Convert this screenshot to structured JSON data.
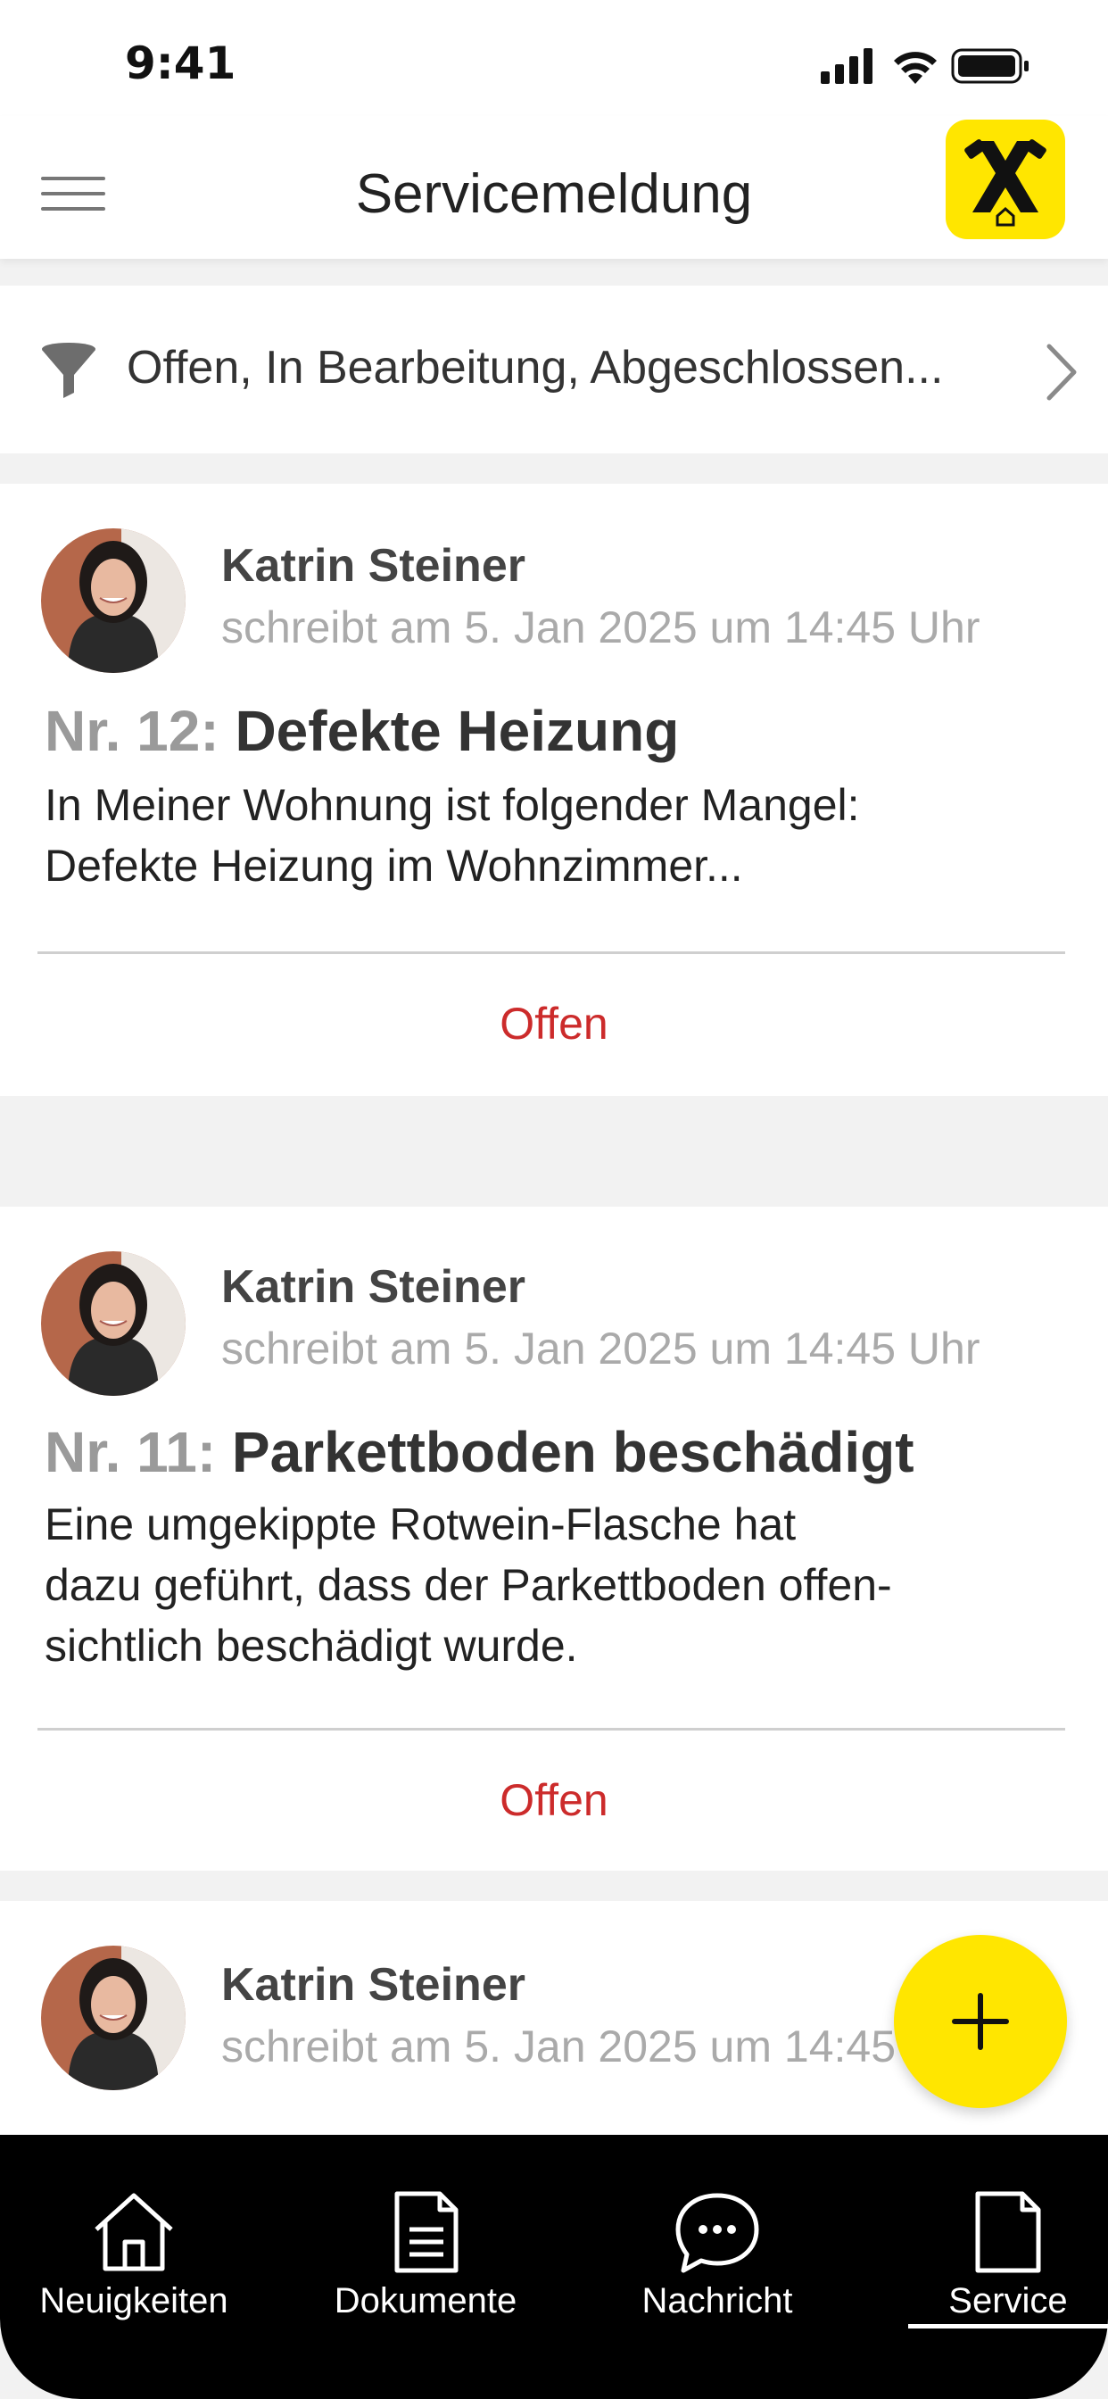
{
  "status_bar": {
    "time": "9:41"
  },
  "header": {
    "title": "Servicemeldung",
    "menu_icon": "hamburger-menu-icon",
    "logo_icon": "raiffeisen-logo"
  },
  "filter": {
    "text": "Offen, In Bearbeitung, Abgeschlossen...",
    "icon": "filter-funnel-icon"
  },
  "messages": [
    {
      "author": "Katrin Steiner",
      "meta": "schreibt am 5. Jan 2025 um 14:45 Uhr",
      "nr": "Nr. 12:",
      "title": "Defekte Heizung",
      "body": "In Meiner Wohnung ist folgender Mangel:\nDefekte Heizung im Wohnzimmer...",
      "status": "Offen"
    },
    {
      "author": "Katrin Steiner",
      "meta": "schreibt am 5. Jan 2025 um 14:45 Uhr",
      "nr": "Nr. 11:",
      "title": "Parkettboden beschädigt",
      "body": "Eine umgekippte Rotwein-Flasche hat\ndazu geführt, dass der Parkettboden offen-\nsichtlich beschädigt wurde.",
      "status": "Offen"
    },
    {
      "author": "Katrin Steiner",
      "meta": "schreibt am 5. Jan 2025 um 14:45 Uhr"
    }
  ],
  "fab": {
    "icon": "plus-icon"
  },
  "tabs": [
    {
      "label": "Neuigkeiten",
      "icon": "home-icon"
    },
    {
      "label": "Dokumente",
      "icon": "document-list-icon"
    },
    {
      "label": "Nachricht",
      "icon": "chat-bubble-icon"
    },
    {
      "label": "Service",
      "icon": "document-icon",
      "active": true
    }
  ],
  "colors": {
    "accent": "#ffe600",
    "status_open": "#cc2b2b",
    "tab_bar": "#000000"
  }
}
